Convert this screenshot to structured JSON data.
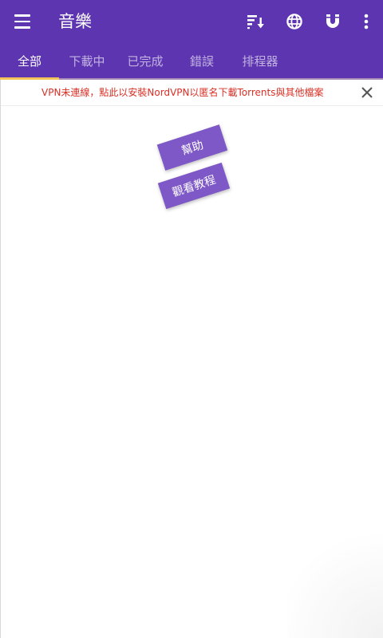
{
  "toolbar": {
    "title": "音樂",
    "icons": [
      "menu-icon",
      "sort-download-icon",
      "globe-icon",
      "magnet-icon",
      "more-vert-icon"
    ]
  },
  "tabs": [
    {
      "label": "全部",
      "active": true
    },
    {
      "label": "下載中",
      "active": false
    },
    {
      "label": "已完成",
      "active": false
    },
    {
      "label": "錯誤",
      "active": false
    },
    {
      "label": "排程器",
      "active": false
    }
  ],
  "banner": {
    "text": "VPN未連線，點此以安裝NordVPN以匿名下載Torrents與其他檔案"
  },
  "help": {
    "help_label": "幫助",
    "tutorial_label": "觀看教程"
  },
  "colors": {
    "primary": "#5d35b0",
    "tab_indicator": "#f2c35b",
    "banner_text": "#d93025",
    "pill": "#7d58c6"
  }
}
